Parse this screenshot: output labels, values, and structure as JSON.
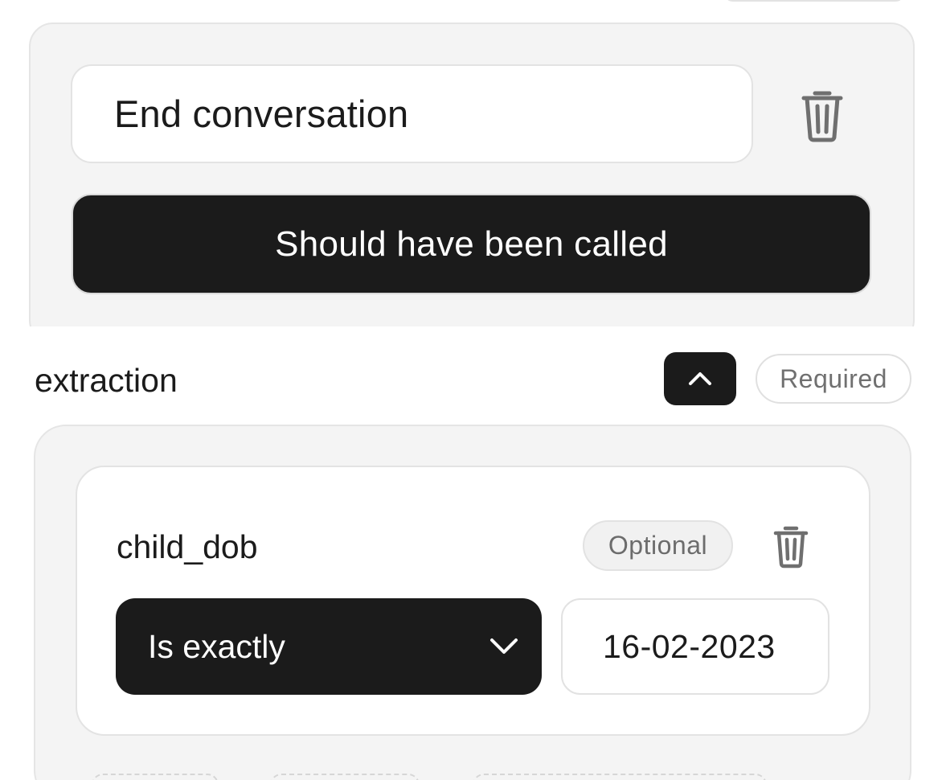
{
  "tool": {
    "name": "End conversation",
    "called_toggle_label": "Should have been called",
    "delete_icon": "trash-icon"
  },
  "extraction": {
    "title": "extraction",
    "collapse_icon": "chevron-up-icon",
    "badge": "Required",
    "field": {
      "name": "child_dob",
      "badge": "Optional",
      "delete_icon": "trash-icon",
      "operator": "Is exactly",
      "operator_icon": "chevron-down-icon",
      "value": "16-02-2023"
    }
  },
  "colors": {
    "dark": "#1b1b1b",
    "panel": "#f4f4f4",
    "border": "#e5e5e5",
    "muted_text": "#707070"
  }
}
